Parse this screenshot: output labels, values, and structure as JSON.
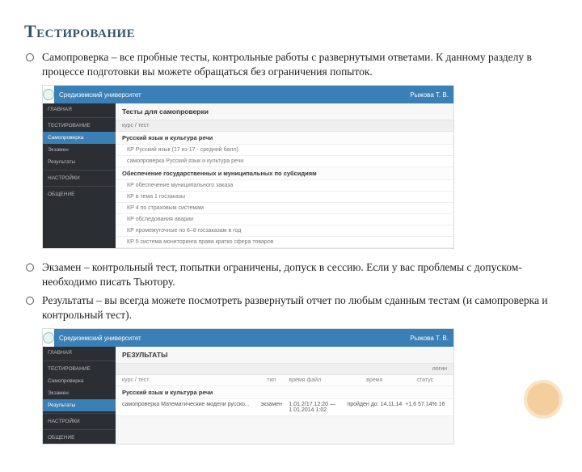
{
  "title": "Тестирование",
  "bullets": {
    "b1": "Самопроверка – все пробные тесты, контрольные работы с развернутыми ответами. К данному разделу в процессе подготовки вы можете обращаться без ограничения попыток.",
    "b2": "Экзамен – контрольный тест, попытки ограничены, допуск в сессию. Если у вас проблемы с допуском- необходимо писать Тьютору.",
    "b3": "Результаты – вы всегда можете посмотреть развернутый отчет по любым сданным тестам (и самопроверка и контрольный тест)."
  },
  "shot1": {
    "header_left": "Средиземский университет",
    "header_right": "Рыжова Т. В.",
    "sidebar": {
      "s0": "ГЛАВНАЯ",
      "s1": "ТЕСТИРОВАНИЕ",
      "s2": "Самопроверка",
      "s3": "Экзамен",
      "s4": "Результаты",
      "s5": "НАСТРОЙКИ",
      "s6": "ОБЩЕНИЕ"
    },
    "main_title": "Тесты для самопроверки",
    "bar": "курс / тест",
    "group1": "Русский язык и культура речи",
    "row1": "КР Русский язык (17 из 17 - средний балл)",
    "row2": "самопроверка  Русский язык и культура речи",
    "group2": "Обеспечение государственных и муниципальных по субсидиям",
    "row3": "КР обеспечение муниципального заказа",
    "row4": "КР в тема 1 госзаказы",
    "row5": "КР 4 по страховым системам",
    "row6": "КР обследования аварии",
    "row7": "КР промежуточные по 6–8 госзаказам в год",
    "row8": "КР 5 система мониторинга  права  кратко сфера товаров"
  },
  "shot2": {
    "header_left": "Средиземский университет",
    "header_right": "Рыжова Т. В.",
    "sidebar": {
      "s0": "ГЛАВНАЯ",
      "s1": "ТЕСТИРОВАНИЕ",
      "s2": "Самопроверка",
      "s3": "Экзамен",
      "s4": "Результаты",
      "s5": "НАСТРОЙКИ",
      "s6": "ОБЩЕНИЕ"
    },
    "main_title": "РЕЗУЛЬТАТЫ",
    "thead": {
      "c1": "курс / тест",
      "c2": "тип",
      "c3": "время файл",
      "c4": "время",
      "c5": "статус"
    },
    "log_right": "логин",
    "group": "Русский язык и культура речи",
    "row": {
      "c1": "самопроверка Математические модели русско...",
      "c2": "экзамен",
      "c3": "1.01.2/17.12:20 — 1.01.2014   1:02",
      "c4": "пройден до: 14.11.14",
      "c5": "+1,6 57.14%  16"
    }
  }
}
